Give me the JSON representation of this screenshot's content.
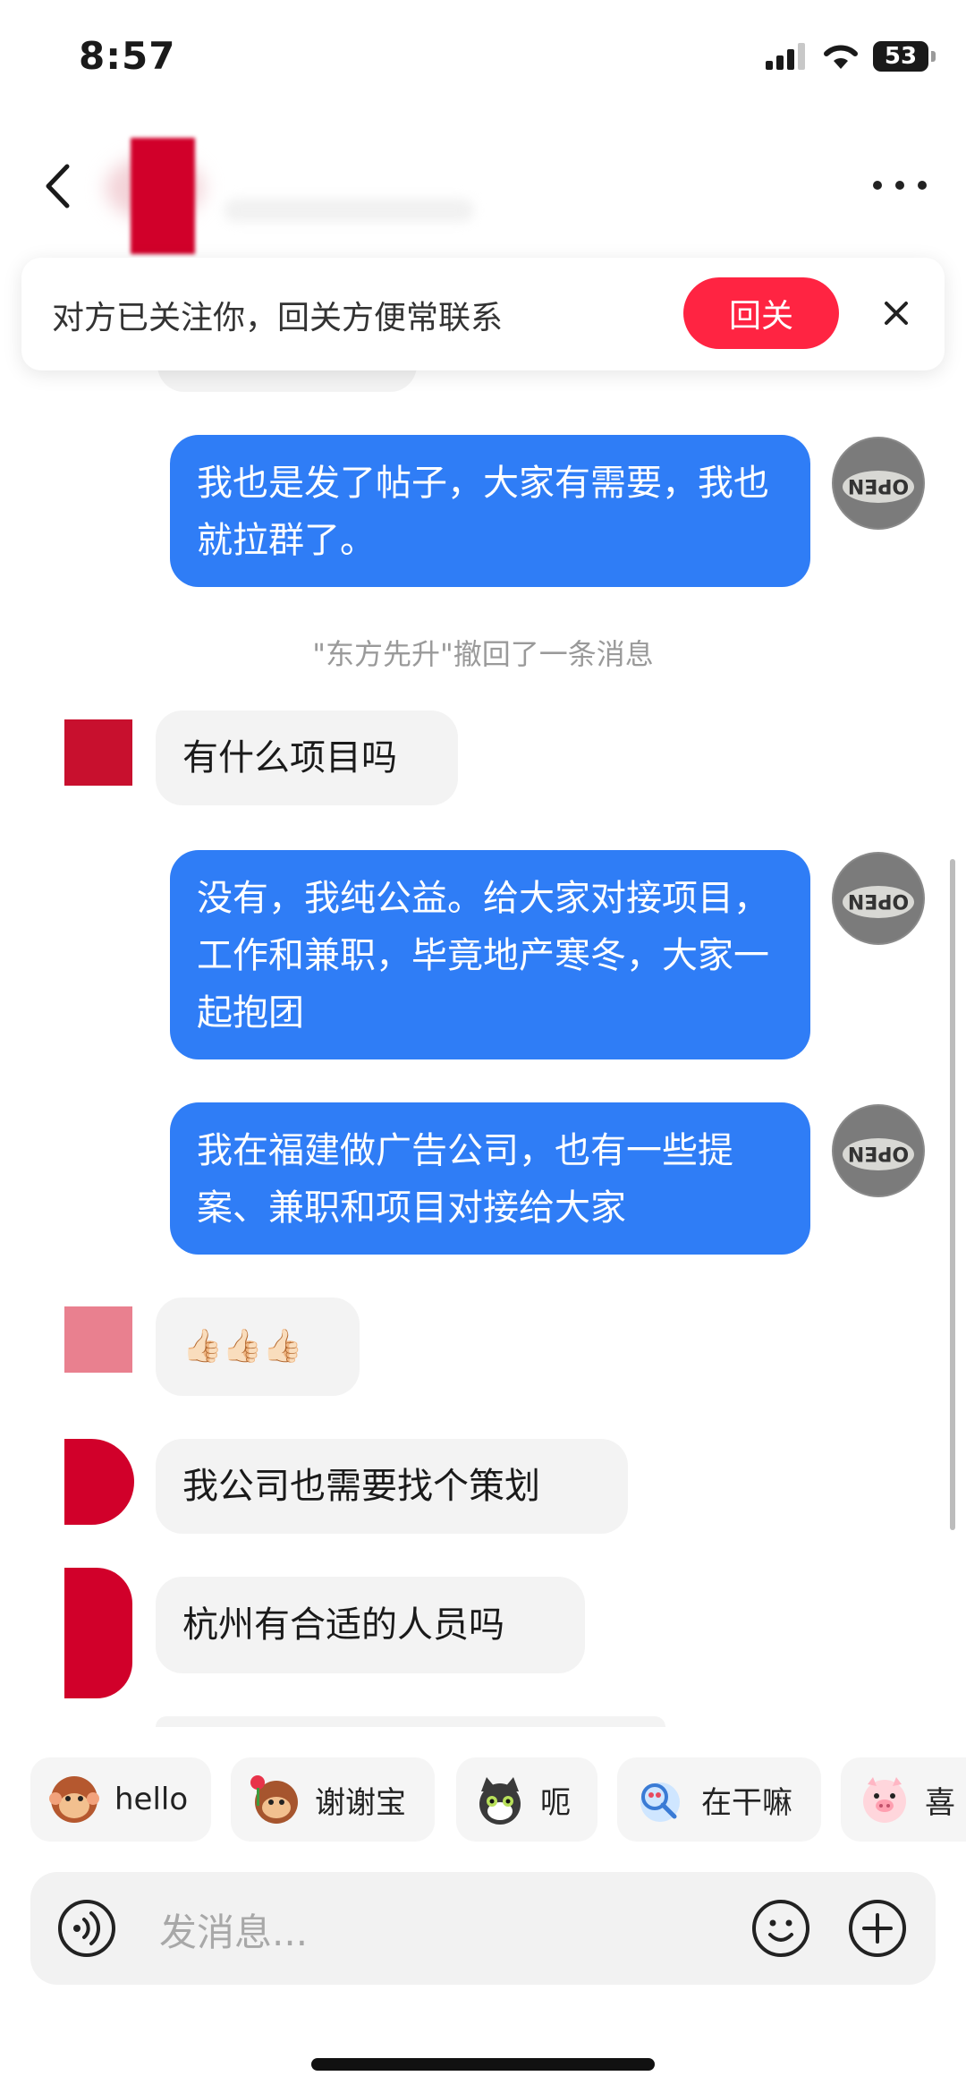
{
  "status_bar": {
    "time": "8:57",
    "battery": "53"
  },
  "header": {
    "back_label": "back",
    "more_label": "more"
  },
  "follow_banner": {
    "text": "对方已关注你，回关方便常联系",
    "button": "回关"
  },
  "messages": [
    {
      "side": "me",
      "text": "我也是发了帖子，大家有需要，我也就拉群了。"
    },
    {
      "side": "system",
      "text": "\"东方先升\"撤回了一条消息"
    },
    {
      "side": "other",
      "text": "有什么项目吗"
    },
    {
      "side": "me",
      "text": "没有，我纯公益。给大家对接项目，工作和兼职，毕竟地产寒冬，大家一起抱团"
    },
    {
      "side": "me",
      "text": "我在福建做广告公司，也有一些提案、兼职和项目对接给大家"
    },
    {
      "side": "other",
      "text": "👍🏻👍🏻👍🏻"
    },
    {
      "side": "other",
      "text": "我公司也需要找个策划"
    },
    {
      "side": "other",
      "text": "杭州有合适的人员吗"
    }
  ],
  "quick_replies": [
    {
      "label": "hello",
      "sticker": "monkey-icon"
    },
    {
      "label": "谢谢宝",
      "sticker": "rose-monkey-icon"
    },
    {
      "label": "呃",
      "sticker": "cat-icon"
    },
    {
      "label": "在干嘛",
      "sticker": "magnifier-character-icon"
    },
    {
      "label": "喜",
      "sticker": "pig-icon"
    }
  ],
  "input": {
    "placeholder": "发消息..."
  },
  "colors": {
    "accent_red": "#ff2442",
    "my_bubble": "#2f7df6",
    "other_bubble": "#f3f3f3"
  }
}
